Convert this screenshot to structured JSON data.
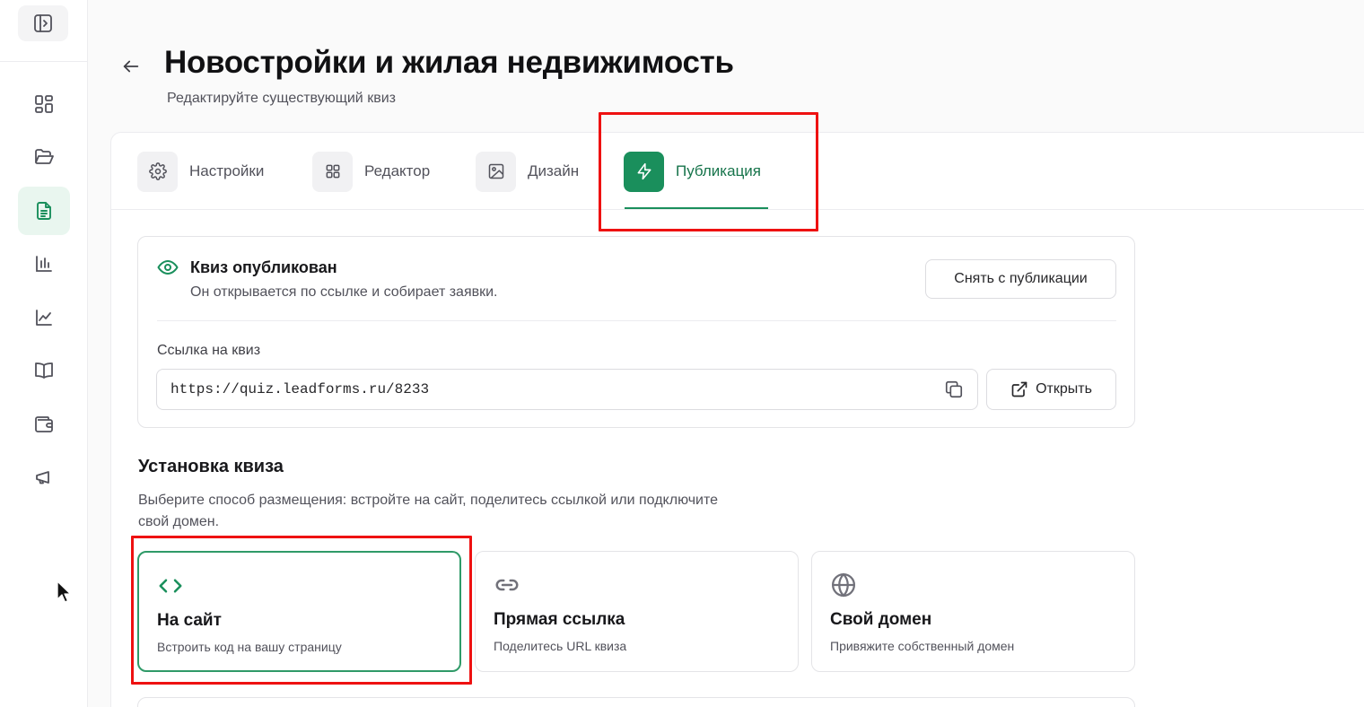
{
  "header": {
    "title": "Новостройки и жилая недвижимость",
    "subtitle": "Редактируйте существующий квиз"
  },
  "tabs": [
    {
      "label": "Настройки",
      "icon": "gear-icon"
    },
    {
      "label": "Редактор",
      "icon": "grid-icon"
    },
    {
      "label": "Дизайн",
      "icon": "image-icon"
    },
    {
      "label": "Публикация",
      "icon": "lightning-icon",
      "active": true
    }
  ],
  "publish": {
    "title": "Квиз опубликован",
    "description": "Он открывается по ссылке и собирает заявки.",
    "unpublish_label": "Снять с публикации",
    "link_label": "Ссылка на квиз",
    "link_value": "https://quiz.leadforms.ru/8233",
    "open_label": "Открыть"
  },
  "install": {
    "title": "Установка квиза",
    "description": "Выберите способ размещения: встройте на сайт, поделитесь ссылкой или подключите свой домен.",
    "options": [
      {
        "title": "На сайт",
        "desc": "Встроить код на вашу страницу",
        "icon": "code-icon",
        "selected": true
      },
      {
        "title": "Прямая ссылка",
        "desc": "Поделитесь URL квиза",
        "icon": "link-icon"
      },
      {
        "title": "Свой домен",
        "desc": "Привяжите собственный домен",
        "icon": "globe-icon"
      }
    ]
  },
  "sidebar": {
    "items": [
      "dashboard-icon",
      "folder-icon",
      "document-icon",
      "bar-chart-icon",
      "line-chart-icon",
      "book-icon",
      "wallet-icon",
      "megaphone-icon"
    ],
    "active": "document-icon"
  },
  "colors": {
    "accent": "#1a8f5c",
    "accent_text": "#17744b",
    "highlight": "#ee1111"
  }
}
